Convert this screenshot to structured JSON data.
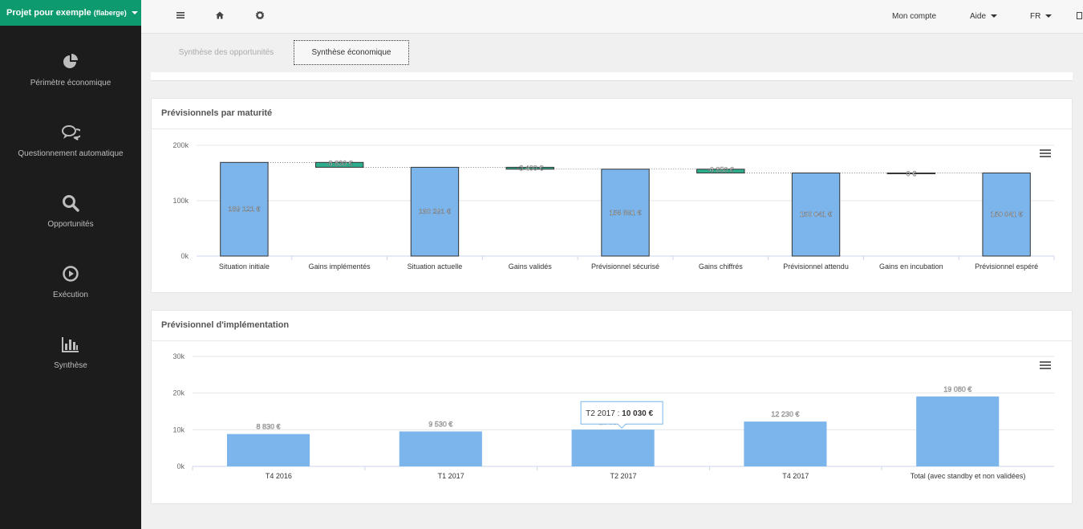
{
  "project": {
    "name": "Projet pour exemple",
    "owner": "(flaberge)"
  },
  "sidebar": {
    "items": [
      {
        "label": "Périmètre économique",
        "icon": "pie-chart-icon"
      },
      {
        "label": "Questionnement automatique",
        "icon": "comments-icon"
      },
      {
        "label": "Opportunités",
        "icon": "search-icon"
      },
      {
        "label": "Exécution",
        "icon": "play-circle-icon"
      },
      {
        "label": "Synthèse",
        "icon": "bar-chart-icon"
      }
    ]
  },
  "topbar": {
    "account": "Mon compte",
    "help": "Aide",
    "language": "FR"
  },
  "tabs": [
    {
      "label": "Synthèse des opportunités",
      "active": false
    },
    {
      "label": "Synthèse économique",
      "active": true
    }
  ],
  "colors": {
    "accent": "#0e9a6f",
    "bar": "#7cb5ec",
    "waterfall_delta": "#2cae8c"
  },
  "charts": {
    "maturity": {
      "title": "Prévisionnels par maturité"
    },
    "implementation": {
      "title": "Prévisionnel d'implémentation"
    }
  },
  "chart_data": [
    {
      "type": "bar",
      "subtype": "waterfall",
      "title": "Prévisionnels par maturité",
      "categories": [
        "Situation initiale",
        "Gains implémentés",
        "Situation actuelle",
        "Gains validés",
        "Prévisionnel sécurisé",
        "Gains chiffrés",
        "Prévisionnel attendu",
        "Gains en incubation",
        "Prévisionnel espéré"
      ],
      "values": [
        169121,
        -8830,
        160291,
        -3400,
        156891,
        -6850,
        150041,
        0,
        150041
      ],
      "kinds": [
        "total",
        "delta",
        "total",
        "delta",
        "total",
        "delta",
        "total",
        "delta",
        "total"
      ],
      "labels": [
        "169 121 €",
        "-8 830 €",
        "160 291 €",
        "-3 400 €",
        "156 891 €",
        "-6 850 €",
        "150 041 €",
        "0 €",
        "150 041 €"
      ],
      "yticks": [
        "0k",
        "100k",
        "200k"
      ],
      "ylim": [
        0,
        200000
      ],
      "grid": true
    },
    {
      "type": "bar",
      "title": "Prévisionnel d'implémentation",
      "categories": [
        "T4 2016",
        "T1 2017",
        "T2 2017",
        "T4 2017",
        "Total (avec standby et non validées)"
      ],
      "values": [
        8830,
        9530,
        10030,
        12230,
        19080
      ],
      "labels": [
        "8 830 €",
        "9 530 €",
        "10 030 €",
        "12 230 €",
        "19 080 €"
      ],
      "yticks": [
        "0k",
        "10k",
        "20k",
        "30k"
      ],
      "ylim": [
        0,
        30000
      ],
      "grid": true,
      "tooltip": {
        "category": "T2 2017",
        "value": "10 030 €"
      }
    }
  ]
}
